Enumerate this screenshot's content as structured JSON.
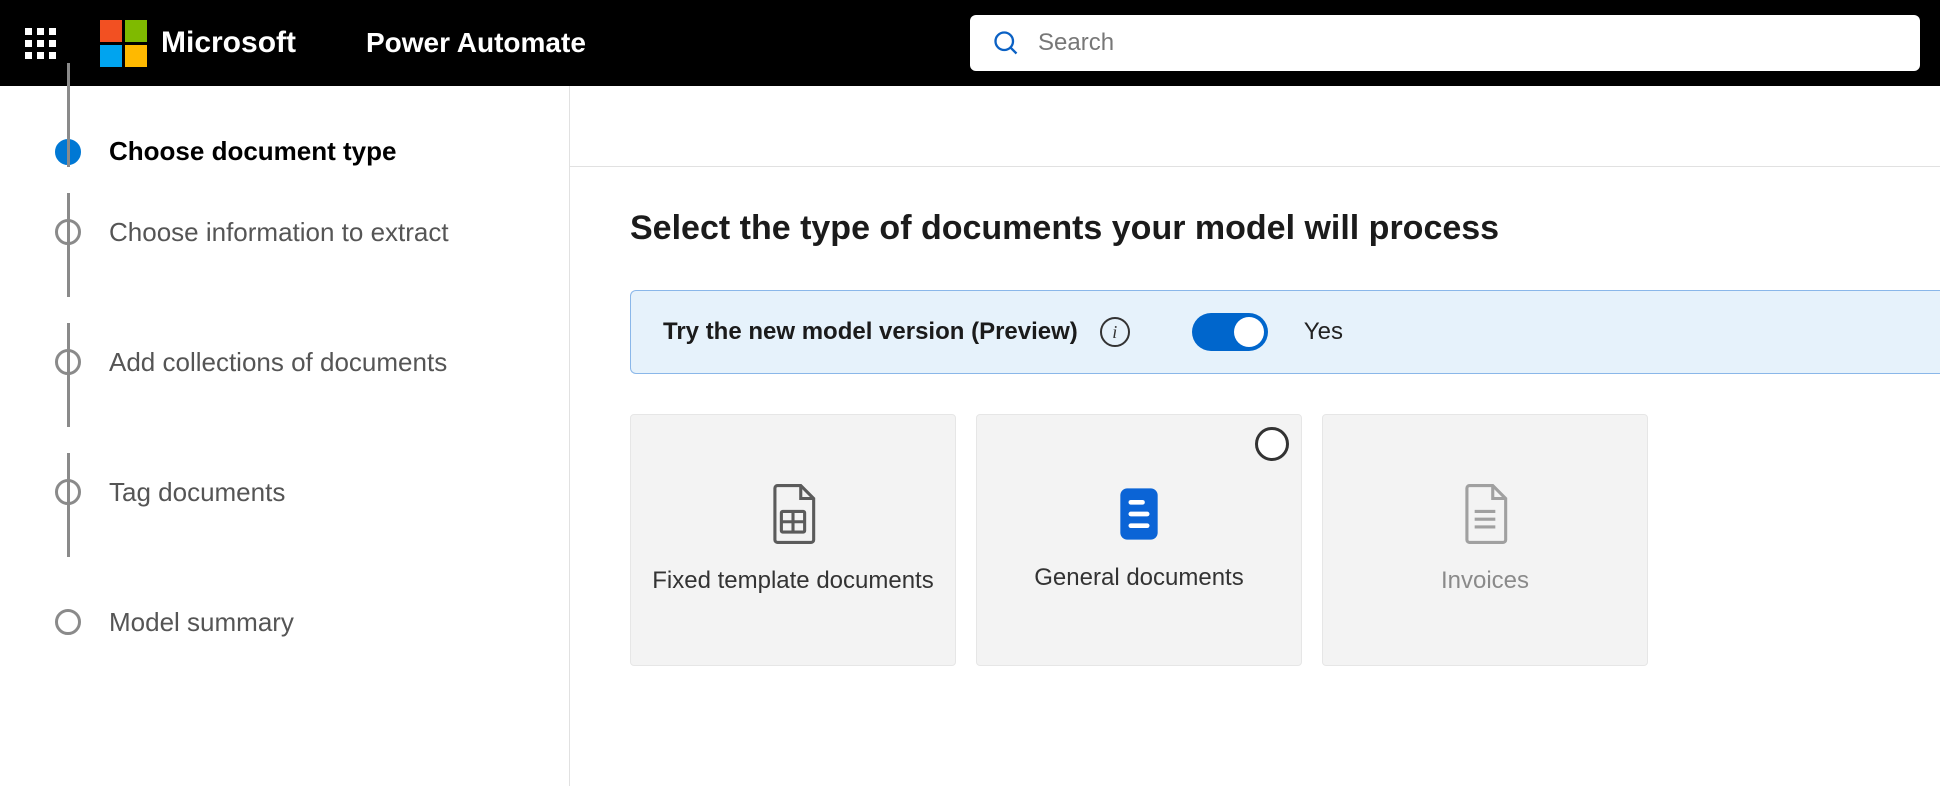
{
  "header": {
    "brand": "Microsoft",
    "app_name": "Power Automate",
    "search_placeholder": "Search"
  },
  "sidebar": {
    "steps": [
      {
        "label": "Choose document type",
        "active": true
      },
      {
        "label": "Choose information to extract",
        "active": false
      },
      {
        "label": "Add collections of documents",
        "active": false
      },
      {
        "label": "Tag documents",
        "active": false
      },
      {
        "label": "Model summary",
        "active": false
      }
    ]
  },
  "main": {
    "title": "Select the type of documents your model will process",
    "banner": {
      "text": "Try the new model version (Preview)",
      "toggle_state": "on",
      "toggle_label": "Yes"
    },
    "cards": [
      {
        "title": "Fixed template documents",
        "icon": "document-grid",
        "selected": false,
        "dim": false
      },
      {
        "title": "General documents",
        "icon": "document-lines-blue",
        "selected": true,
        "dim": false
      },
      {
        "title": "Invoices",
        "icon": "document-invoice",
        "selected": false,
        "dim": true
      }
    ]
  }
}
